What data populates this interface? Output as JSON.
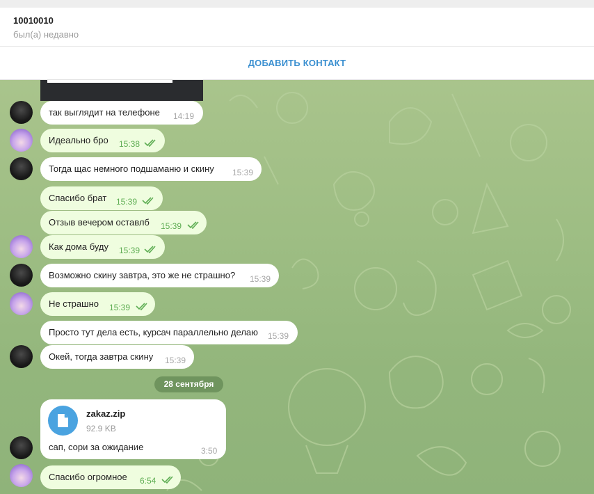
{
  "header": {
    "name": "10010010",
    "status": "был(а) недавно"
  },
  "add_contact": {
    "label": "ДОБАВИТЬ КОНТАКТ"
  },
  "messages": [
    {
      "text": "так выглядит на телефоне",
      "time": "14:19",
      "direction": "incoming",
      "read": false
    },
    {
      "text": "Идеально бро",
      "time": "15:38",
      "direction": "outgoing",
      "read": true
    },
    {
      "text": "Тогда щас немного подшаманю и скину",
      "time": "15:39",
      "direction": "incoming",
      "read": false
    },
    {
      "text": "Спасибо брат",
      "time": "15:39",
      "direction": "outgoing",
      "read": true
    },
    {
      "text": "Отзыв вечером оставлб",
      "time": "15:39",
      "direction": "outgoing",
      "read": true
    },
    {
      "text": "Как дома буду",
      "time": "15:39",
      "direction": "outgoing",
      "read": true
    },
    {
      "text": "Возможно скину завтра, это же не страшно?",
      "time": "15:39",
      "direction": "incoming",
      "read": false
    },
    {
      "text": "Не страшно",
      "time": "15:39",
      "direction": "outgoing",
      "read": true
    },
    {
      "text": "Просто тут дела есть, курсач параллельно делаю",
      "time": "15:39",
      "direction": "incoming",
      "read": false
    },
    {
      "text": "Окей, тогда завтра скину",
      "time": "15:39",
      "direction": "incoming",
      "read": false
    },
    {
      "text": "Спасибо огромное",
      "time": "6:54",
      "direction": "outgoing",
      "read": true
    }
  ],
  "date_divider": "28 сентября",
  "file_message": {
    "file_name": "zakaz.zip",
    "file_size": "92.9 KB",
    "text": "сап, сори за ожидание",
    "time": "3:50",
    "icon": "file-icon"
  },
  "colors": {
    "accent": "#3a8fd0",
    "outgoing_bubble": "#effddf",
    "incoming_bubble": "#ffffff",
    "read_check": "#5fae54",
    "chat_background": "#9dbd83"
  }
}
